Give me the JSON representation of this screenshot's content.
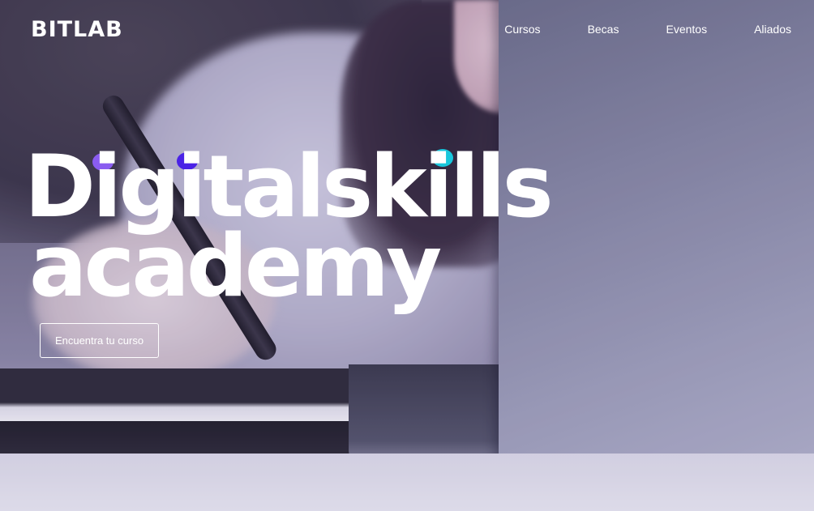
{
  "brand": {
    "logo_text": "BITLAB"
  },
  "nav": {
    "items": [
      {
        "label": "Cursos"
      },
      {
        "label": "Becas"
      },
      {
        "label": "Eventos"
      },
      {
        "label": "Aliados"
      }
    ]
  },
  "hero": {
    "headline_line1": "Digitalskills",
    "headline_line2": "academy",
    "cta_label": "Encuentra tu curso",
    "accent_dots": [
      {
        "name": "purple-dot",
        "color": "#8a5cf0"
      },
      {
        "name": "indigo-dot",
        "color": "#4a22e6"
      },
      {
        "name": "cyan-dot",
        "color": "#18c6dc"
      }
    ]
  },
  "colors": {
    "text": "#ffffff",
    "dot_purple": "#8a5cf0",
    "dot_indigo": "#4a22e6",
    "dot_cyan": "#18c6dc"
  }
}
